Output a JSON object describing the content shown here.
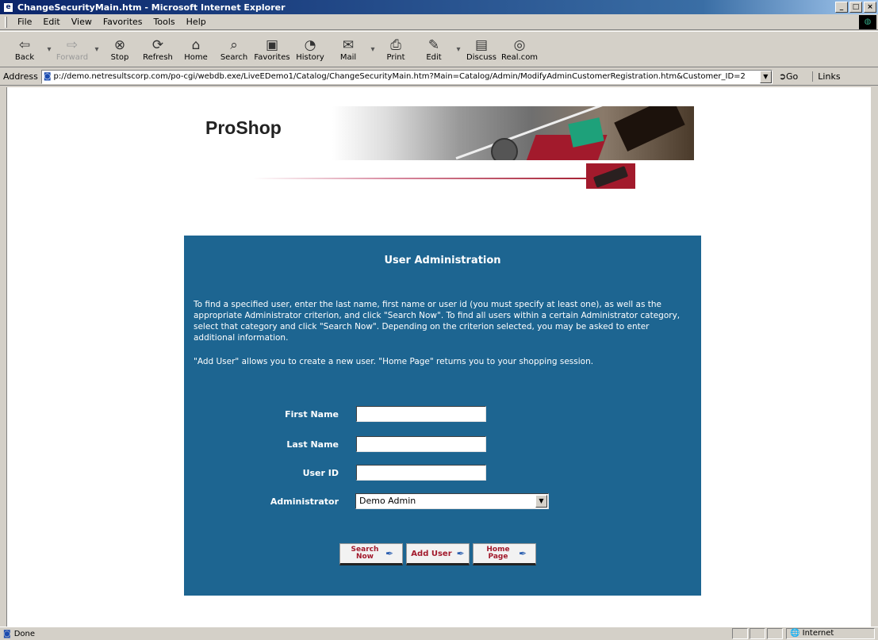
{
  "window": {
    "title": "ChangeSecurityMain.htm - Microsoft Internet Explorer",
    "buttons": [
      "_",
      "□",
      "×"
    ]
  },
  "menu": [
    "File",
    "Edit",
    "View",
    "Favorites",
    "Tools",
    "Help"
  ],
  "toolbar": [
    {
      "label": "Back",
      "icon": "⇦",
      "enabled": true
    },
    {
      "label": "Forward",
      "icon": "⇨",
      "enabled": false
    },
    {
      "label": "Stop",
      "icon": "⊗",
      "enabled": true
    },
    {
      "label": "Refresh",
      "icon": "⟳",
      "enabled": true
    },
    {
      "label": "Home",
      "icon": "⌂",
      "enabled": true
    },
    {
      "label": "Search",
      "icon": "⌕",
      "enabled": true
    },
    {
      "label": "Favorites",
      "icon": "▣",
      "enabled": true
    },
    {
      "label": "History",
      "icon": "◔",
      "enabled": true
    },
    {
      "label": "Mail",
      "icon": "✉",
      "enabled": true
    },
    {
      "label": "Print",
      "icon": "⎙",
      "enabled": true
    },
    {
      "label": "Edit",
      "icon": "✎",
      "enabled": true
    },
    {
      "label": "Discuss",
      "icon": "▤",
      "enabled": true
    },
    {
      "label": "Real.com",
      "icon": "◎",
      "enabled": true
    }
  ],
  "address": {
    "label": "Address",
    "url": "p://demo.netresultscorp.com/po-cgi/webdb.exe/LiveEDemo1/Catalog/ChangeSecurityMain.htm?Main=Catalog/Admin/ModifyAdminCustomerRegistration.htm&Customer_ID=2",
    "go": "Go",
    "links": "Links"
  },
  "page": {
    "logo": "ProShop",
    "panel_title": "User Administration",
    "instructions": "To find a specified user, enter the last name, first name or user id (you must specify at least one), as well as the appropriate Administrator criterion, and click \"Search Now\". To find all users within a certain Administrator category, select that category and click \"Search Now\". Depending on the criterion selected, you may be asked to enter additional information.",
    "instructions2": "\"Add User\" allows you to create a new user. \"Home Page\" returns you to your shopping session.",
    "fields": {
      "first_name": {
        "label": "First Name",
        "value": ""
      },
      "last_name": {
        "label": "Last Name",
        "value": ""
      },
      "user_id": {
        "label": "User ID",
        "value": ""
      },
      "administrator": {
        "label": "Administrator",
        "value": "Demo Admin"
      }
    },
    "buttons": {
      "search": "Search Now",
      "add_user": "Add User",
      "home": "Home Page"
    }
  },
  "status": {
    "text": "Done",
    "zone": "Internet"
  },
  "colors": {
    "panel": "#1d6591",
    "accent": "#a21a2c",
    "chrome": "#d4d0c8"
  }
}
